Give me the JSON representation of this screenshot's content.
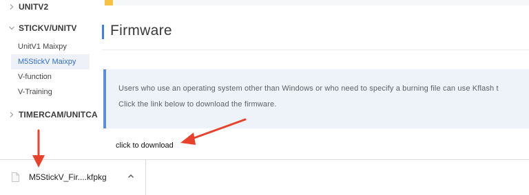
{
  "sidebar": {
    "sections": [
      {
        "label": "UNITV2",
        "icon": "chevron-right-icon"
      },
      {
        "label": "STICKV/UNITV",
        "icon": "chevron-down-icon"
      },
      {
        "label": "TIMERCAM/UNITCAM",
        "icon": "chevron-right-icon"
      }
    ],
    "items": [
      {
        "label": "UnitV1 Maixpy",
        "active": false
      },
      {
        "label": "M5StickV Maixpy",
        "active": true
      },
      {
        "label": "V-function",
        "active": false
      },
      {
        "label": "V-Training",
        "active": false
      }
    ]
  },
  "main": {
    "title": "Firmware",
    "notice_lines": [
      "Users who use an operating system other than Windows or who need to specify a burning file can use Kflash t",
      "Click the link below to download the firmware."
    ],
    "download_link": "click to download"
  },
  "download_bar": {
    "file_name": "M5StickV_Fir....kfpkg",
    "file_icon": "file-icon",
    "caret_icon": "chevron-up-icon"
  },
  "colors": {
    "accent_blue": "#3f7fe0",
    "active_text": "#2f6fcf",
    "notice_bg": "#eef3f9",
    "annotation_red": "#e8412c",
    "top_accent": "#f5c243"
  }
}
